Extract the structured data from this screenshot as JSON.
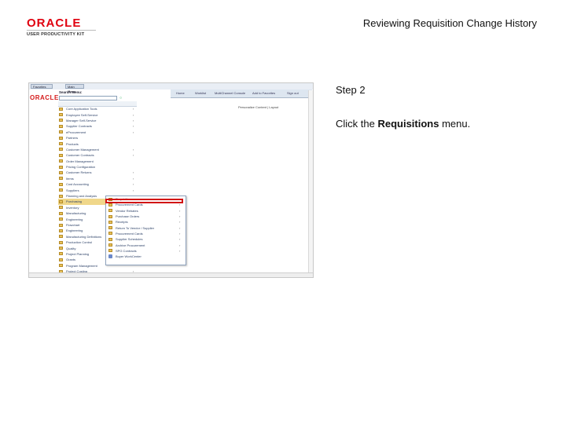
{
  "logo": {
    "brand": "ORACLE",
    "tagline": "USER PRODUCTIVITY KIT"
  },
  "document_title": "Reviewing Requisition Change History",
  "step": {
    "title": "Step 2",
    "instruction_prefix": "Click the ",
    "instruction_target": "Requisitions",
    "instruction_suffix": " menu."
  },
  "screenshot": {
    "nav_tabs": [
      "Favorites",
      "Main Menu"
    ],
    "oracle_mini": "ORACLE",
    "top_links": [
      "Home",
      "Worklist",
      "MultiChannel Console",
      "Add to Favorites",
      "Sign out"
    ],
    "search_label": "Search Menu:",
    "personalize": "Personalize Content | Layout",
    "menu_items": [
      {
        "label": "Core Application Tools",
        "arrow": "›"
      },
      {
        "label": "Employee Self-Service",
        "arrow": "›"
      },
      {
        "label": "Manager Self-Service",
        "arrow": "›"
      },
      {
        "label": "Supplier Contracts",
        "arrow": "›"
      },
      {
        "label": "eProcurement",
        "arrow": "›"
      },
      {
        "label": "Partners",
        "arrow": ""
      },
      {
        "label": "Products",
        "arrow": ""
      },
      {
        "label": "Customer Management",
        "arrow": "›"
      },
      {
        "label": "Customer Contracts",
        "arrow": "›"
      },
      {
        "label": "Order Management",
        "arrow": ""
      },
      {
        "label": "Pricing Configuration",
        "arrow": ""
      },
      {
        "label": "Customer Returns",
        "arrow": "›"
      },
      {
        "label": "Items",
        "arrow": "›"
      },
      {
        "label": "Cost Accounting",
        "arrow": "›"
      },
      {
        "label": "Suppliers",
        "arrow": "›"
      },
      {
        "label": "Planning and Analysis",
        "arrow": ""
      },
      {
        "label": "Purchasing",
        "arrow": "›",
        "active": true
      },
      {
        "label": "Inventory",
        "arrow": ""
      },
      {
        "label": "Manufacturing",
        "arrow": ""
      },
      {
        "label": "Engineering",
        "arrow": ""
      },
      {
        "label": "Flowchart",
        "arrow": ""
      },
      {
        "label": "Engineering",
        "arrow": ""
      },
      {
        "label": "Manufacturing Definitions",
        "arrow": ""
      },
      {
        "label": "Production Control",
        "arrow": ""
      },
      {
        "label": "Quality",
        "arrow": ""
      },
      {
        "label": "Project Planning",
        "arrow": ""
      },
      {
        "label": "Grants",
        "arrow": ""
      },
      {
        "label": "Program Management",
        "arrow": ""
      },
      {
        "label": "Project Costing",
        "arrow": "›"
      }
    ],
    "submenu_items": [
      {
        "label": "Requisitions",
        "arrow": "›",
        "icon": "folder"
      },
      {
        "label": "Procurement Cards",
        "arrow": "›",
        "icon": "folder"
      },
      {
        "label": "Vendor Rebates",
        "arrow": "›",
        "icon": "folder"
      },
      {
        "label": "Purchase Orders",
        "arrow": "›",
        "icon": "folder"
      },
      {
        "label": "Receipts",
        "arrow": "›",
        "icon": "folder"
      },
      {
        "label": "Return To Vendor / Supplier",
        "arrow": "›",
        "icon": "folder"
      },
      {
        "label": "Procurement Cards",
        "arrow": "›",
        "icon": "folder"
      },
      {
        "label": "Supplier Schedules",
        "arrow": "›",
        "icon": "folder"
      },
      {
        "label": "Archive Procurement",
        "arrow": "›",
        "icon": "folder"
      },
      {
        "label": "SPG Contracts",
        "arrow": "›",
        "icon": "folder"
      },
      {
        "label": "Buyer WorkCenter",
        "arrow": "",
        "icon": "doc"
      }
    ]
  },
  "colors": {
    "oracle_red": "#e0000f",
    "highlight": "#d11313",
    "active_row": "#f0d78a",
    "folder": "#e9c25a"
  }
}
